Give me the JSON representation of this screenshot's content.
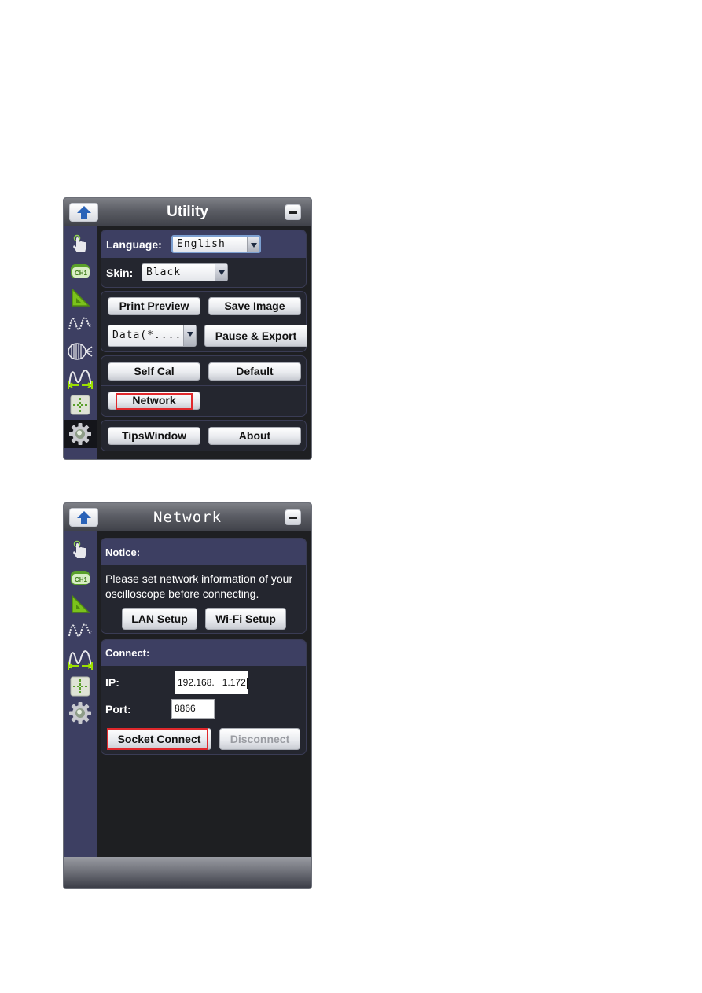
{
  "utility_window": {
    "title": "Utility",
    "sidebar_icons": [
      "touch-icon",
      "ch1-channel-icon",
      "ruler-triangle-icon",
      "waveform-icon",
      "fft-icon",
      "measure-waveform-icon",
      "cursor-crosshair-icon",
      "gear-icon"
    ],
    "active_sidebar": "gear-icon",
    "language_label": "Language:",
    "language_value": "English",
    "skin_label": "Skin:",
    "skin_value": "Black",
    "print_preview_label": "Print Preview",
    "save_image_label": "Save Image",
    "export_format_value": "Data(*....",
    "pause_export_label": "Pause & Export",
    "self_cal_label": "Self Cal",
    "default_label": "Default",
    "network_label": "Network",
    "tips_window_label": "TipsWindow",
    "about_label": "About",
    "highlighted_button": "Network",
    "highlight_color": "#e0282c"
  },
  "network_window": {
    "title": "Network",
    "sidebar_icons": [
      "touch-icon",
      "ch1-channel-icon",
      "ruler-triangle-icon",
      "waveform-icon",
      "measure-waveform-icon",
      "cursor-crosshair-icon",
      "gear-icon"
    ],
    "notice_heading": "Notice:",
    "notice_text_line1": "Please set network information of your",
    "notice_text_line2": "oscilloscope before connecting.",
    "lan_setup_label": "LAN Setup",
    "wifi_setup_label": "Wi-Fi Setup",
    "connect_heading": "Connect:",
    "ip_label": "IP:",
    "ip_value": "192.168.   1.172",
    "port_label": "Port:",
    "port_value": "8866",
    "socket_connect_label": "Socket Connect",
    "disconnect_label": "Disconnect",
    "disconnect_enabled": false,
    "highlighted_button": "Socket Connect",
    "highlight_color": "#e0282c"
  }
}
